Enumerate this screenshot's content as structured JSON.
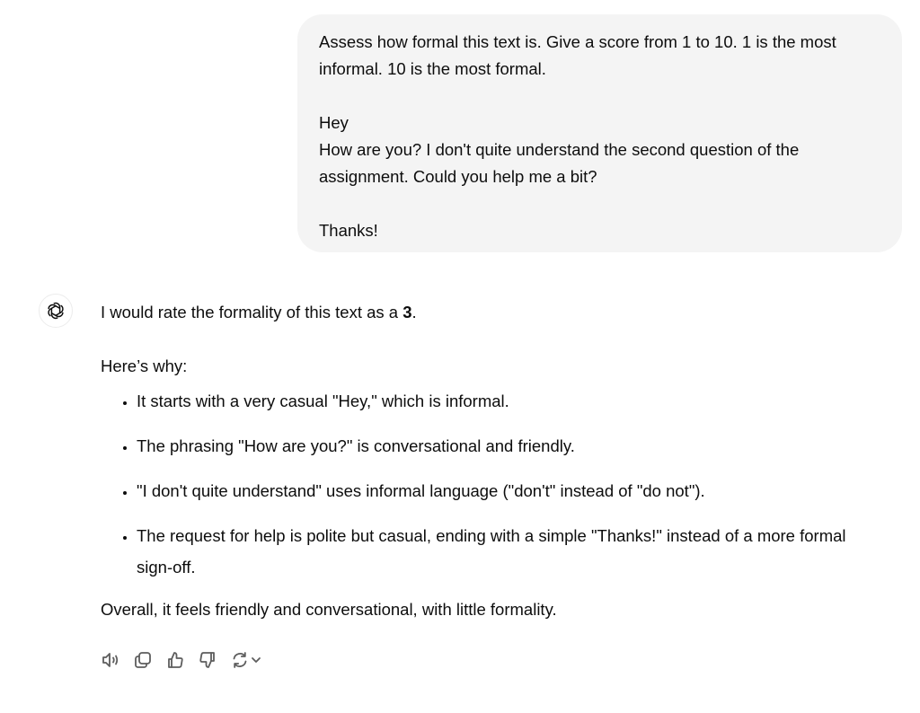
{
  "user_message": {
    "paragraphs": [
      "Assess how formal this text is. Give a score from 1 to 10. 1 is the most informal. 10 is the most formal.",
      "Hey\nHow are you? I don't quite understand the second question of the assignment. Could you help me a bit?",
      "Thanks!"
    ]
  },
  "assistant_message": {
    "avatar_icon": "openai-logo-icon",
    "intro_prefix": "I would rate the formality of this text as a ",
    "intro_score": "3",
    "intro_suffix": ".",
    "reasons_heading": "Here’s why:",
    "reasons": [
      "It starts with a very casual \"Hey,\" which is informal.",
      "The phrasing \"How are you?\" is conversational and friendly.",
      "\"I don't quite understand\" uses informal language (\"don't\" instead of \"do not\").",
      "The request for help is polite but casual, ending with a simple \"Thanks!\" instead of a more formal sign-off."
    ],
    "conclusion": "Overall, it feels friendly and conversational, with little formality."
  },
  "actions": [
    {
      "name": "read-aloud",
      "icon": "speaker-icon"
    },
    {
      "name": "copy",
      "icon": "copy-icon"
    },
    {
      "name": "good-response",
      "icon": "thumbs-up-icon"
    },
    {
      "name": "bad-response",
      "icon": "thumbs-down-icon"
    },
    {
      "name": "regenerate",
      "icon": "refresh-icon"
    }
  ]
}
